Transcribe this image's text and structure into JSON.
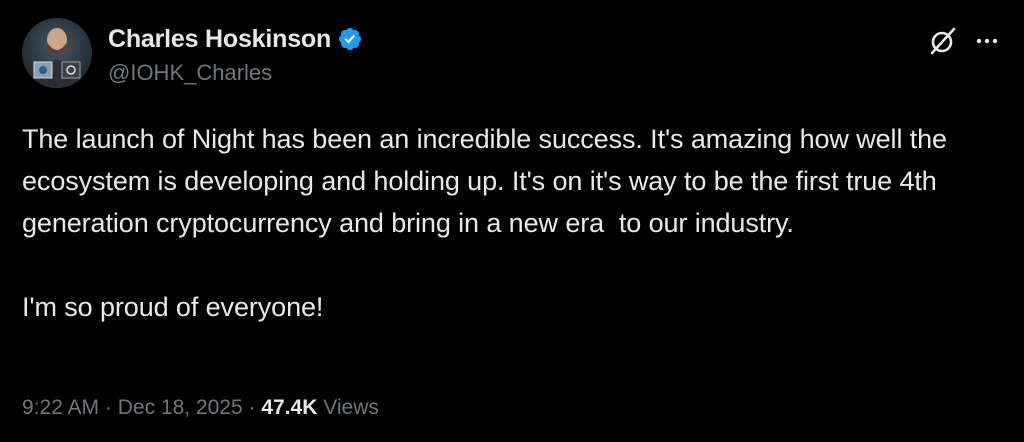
{
  "author": {
    "display_name": "Charles Hoskinson",
    "handle": "@IOHK_Charles",
    "verified": true
  },
  "icons": {
    "avatar": "avatar",
    "verified": "verified-badge-icon",
    "grok": "grok-icon",
    "more": "more-options-icon"
  },
  "tweet": {
    "text": "The launch of Night has been an incredible success. It's amazing how well the ecosystem is developing and holding up. It's on it's way to be the first true 4th generation cryptocurrency and bring in a new era  to our industry.\n\nI'm so proud of everyone!"
  },
  "meta": {
    "time": "9:22 AM",
    "separator": " · ",
    "date": "Dec 18, 2025",
    "separator2": " · ",
    "views_count": "47.4K",
    "views_label": " Views"
  },
  "colors": {
    "background": "#000000",
    "text_primary": "#e7e9ea",
    "text_secondary": "#71767b",
    "verified_blue": "#1d9bf0"
  }
}
